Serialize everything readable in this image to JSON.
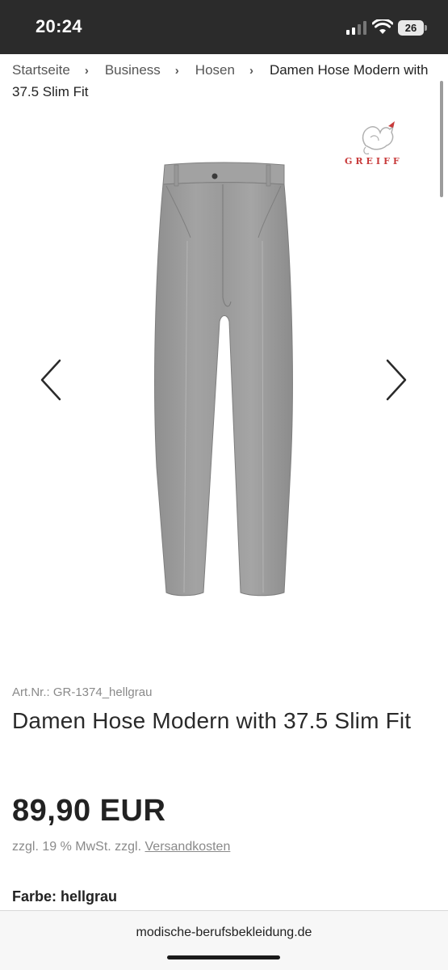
{
  "status_bar": {
    "time": "20:24",
    "battery": "26",
    "icons": [
      "signal-icon",
      "wifi-icon",
      "battery-icon"
    ]
  },
  "breadcrumb": {
    "items": [
      "Startseite",
      "Business",
      "Hosen"
    ],
    "current": "Damen Hose Modern with 37.5 Slim Fit"
  },
  "gallery": {
    "brand": "GREIFF",
    "image": "grey-trousers-product-photo",
    "prev_icon": "chevron-left-icon",
    "next_icon": "chevron-right-icon"
  },
  "product": {
    "art_nr": "Art.Nr.: GR-1374_hellgrau",
    "title": "Damen Hose Modern with 37.5 Slim Fit",
    "price": "89,90 EUR",
    "tax_prefix": "zzgl. 19 % MwSt. zzgl. ",
    "shipping_link": "Versandkosten",
    "color_label": "Farbe: hellgrau"
  },
  "browser": {
    "url": "modische-berufsbekleidung.de"
  },
  "colors": {
    "status_bar_bg": "#2b2b2b",
    "brand_red": "#c83a3a",
    "trousers_grey": "#9b9b9b"
  }
}
